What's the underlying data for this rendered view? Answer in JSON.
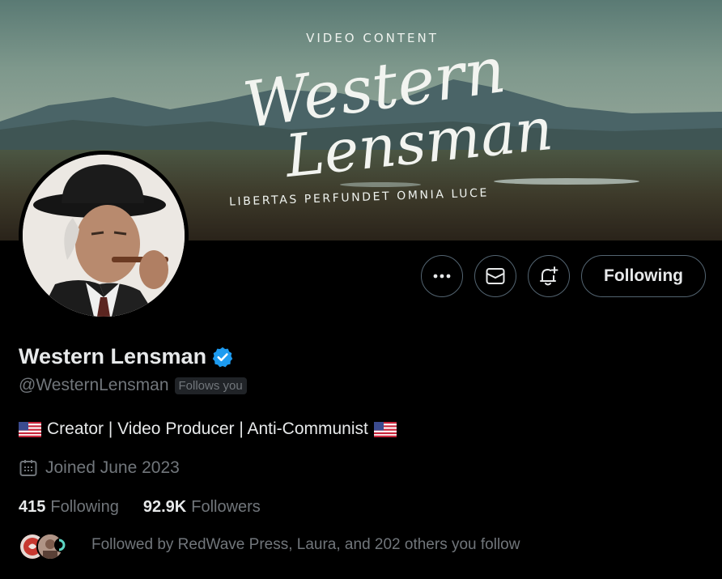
{
  "banner": {
    "top_text": "VIDEO CONTENT",
    "script_line_1": "Western",
    "script_line_2": "Lensman",
    "motto": "LIBERTAS PERFUNDET OMNIA LUCE"
  },
  "actions": {
    "more_icon": "ellipsis-icon",
    "message_icon": "envelope-icon",
    "notify_icon": "bell-plus-icon",
    "following_label": "Following"
  },
  "profile": {
    "display_name": "Western Lensman",
    "verified_icon": "verified-badge-icon",
    "handle": "@WesternLensman",
    "follows_you": "Follows you",
    "bio": "Creator | Video Producer | Anti-Communist",
    "bio_flag_icon": "us-flag-icon",
    "joined_icon": "calendar-icon",
    "joined": "Joined June 2023"
  },
  "stats": {
    "following_count": "415",
    "following_label": "Following",
    "followers_count": "92.9K",
    "followers_label": "Followers"
  },
  "followed_by": {
    "text": "Followed by RedWave Press, Laura, and 202 others you follow"
  },
  "colors": {
    "background": "#000000",
    "primary_text": "#e7e9ea",
    "secondary_text": "#71767b",
    "border": "#536471",
    "verified_blue": "#1d9bf0"
  }
}
